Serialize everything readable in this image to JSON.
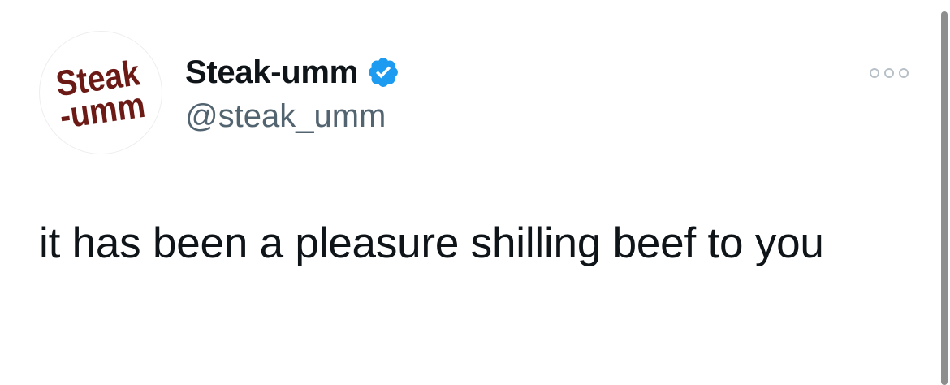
{
  "tweet": {
    "display_name": "Steak-umm",
    "handle": "@steak_umm",
    "verified": true,
    "text": "it has been a pleasure shilling beef to you",
    "avatar": {
      "logo_text_line1": "Steak",
      "logo_text_line2": "-umm",
      "logo_color": "#6b1a16"
    },
    "menu_icon": "more-horizontal-icon"
  },
  "colors": {
    "primary_text": "#0f1419",
    "secondary_text": "#536471",
    "verified_badge": "#1d9bf0",
    "logo": "#6b1a16"
  }
}
